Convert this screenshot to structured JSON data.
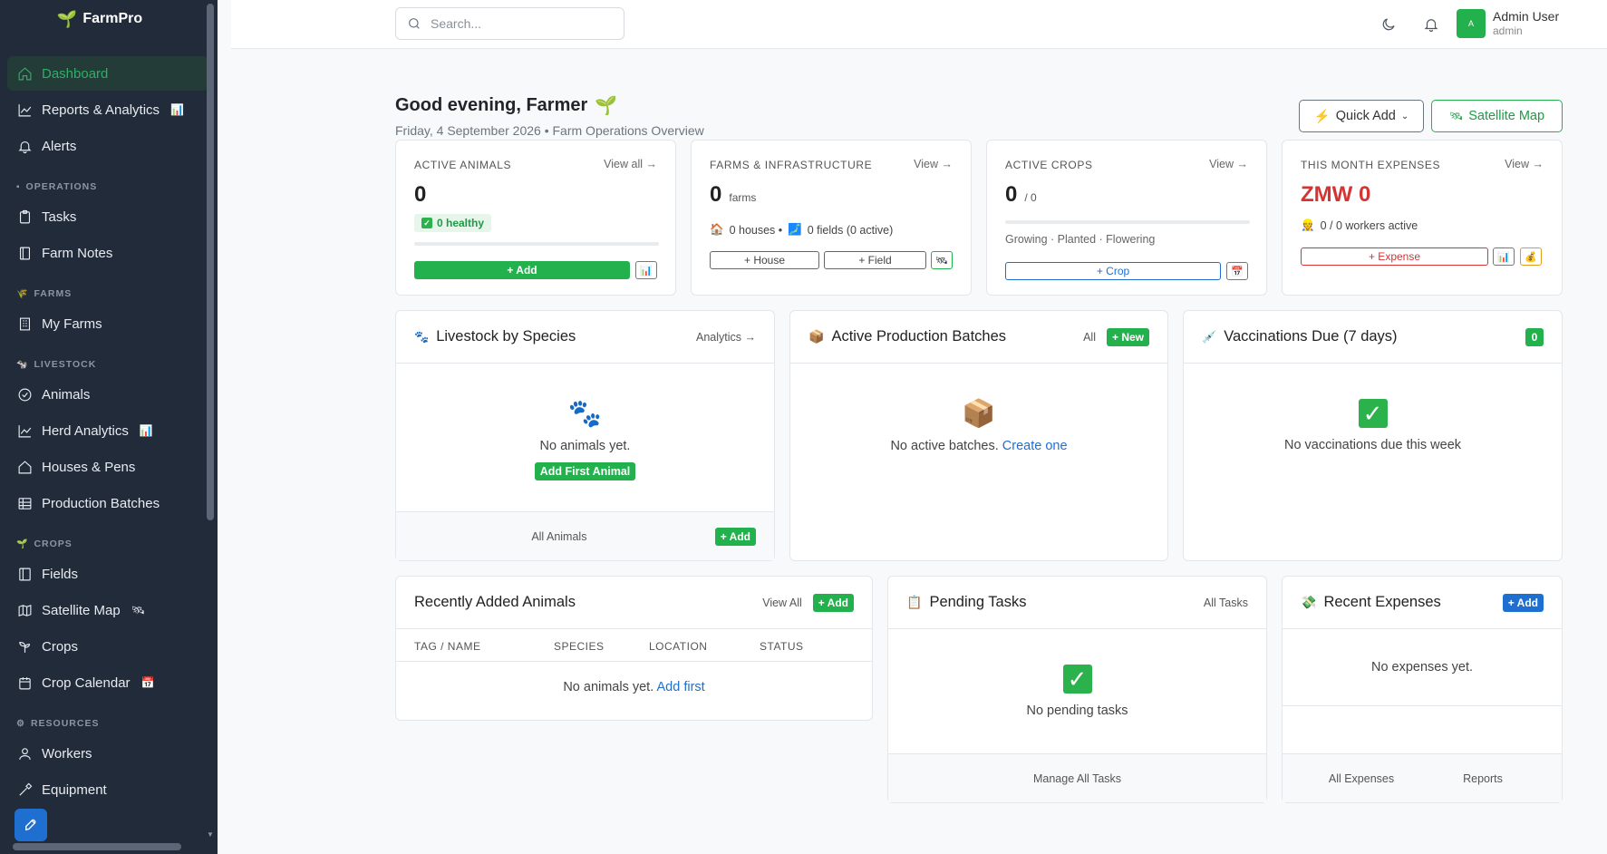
{
  "app": {
    "name": "FarmPro"
  },
  "sidebar": {
    "top": [
      {
        "label": "Dashboard"
      },
      {
        "label": "Reports & Analytics",
        "emoji": "📊"
      },
      {
        "label": "Alerts"
      }
    ],
    "sections": {
      "operations": {
        "label": "OPERATIONS",
        "emoji": "▪",
        "items": [
          {
            "label": "Tasks"
          },
          {
            "label": "Farm Notes"
          }
        ]
      },
      "farms": {
        "label": "FARMS",
        "emoji": "🌾",
        "items": [
          {
            "label": "My Farms"
          }
        ]
      },
      "livestock": {
        "label": "LIVESTOCK",
        "emoji": "🐄",
        "items": [
          {
            "label": "Animals"
          },
          {
            "label": "Herd Analytics",
            "emoji": "📊"
          },
          {
            "label": "Houses & Pens"
          },
          {
            "label": "Production Batches"
          }
        ]
      },
      "crops": {
        "label": "CROPS",
        "emoji": "🌱",
        "items": [
          {
            "label": "Fields"
          },
          {
            "label": "Satellite Map",
            "emoji": "🛰"
          },
          {
            "label": "Crops"
          },
          {
            "label": "Crop Calendar",
            "emoji": "📅"
          }
        ]
      },
      "resources": {
        "label": "RESOURCES",
        "emoji": "⚙",
        "items": [
          {
            "label": "Workers"
          },
          {
            "label": "Equipment"
          }
        ]
      }
    }
  },
  "topbar": {
    "search_placeholder": "Search...",
    "user": {
      "name": "Admin User",
      "role": "admin",
      "initial": "A"
    }
  },
  "header": {
    "greeting": "Good evening, Farmer",
    "greeting_emoji": "🌱",
    "subtitle": "Friday, 4 September 2026 • Farm Operations Overview",
    "quick_add": "Quick Add",
    "satellite_map": "Satellite Map"
  },
  "stats": {
    "animals": {
      "title": "ACTIVE ANIMALS",
      "link": "View all →",
      "value": "0",
      "healthy": "0 healthy",
      "add": "+ Add",
      "progress": 0
    },
    "farms": {
      "title": "FARMS & INFRASTRUCTURE",
      "link": "View →",
      "value": "0",
      "unit": "farms",
      "houses": "0 houses •",
      "fields": "0 fields (0 active)",
      "add_house": "+ House",
      "add_field": "+ Field"
    },
    "crops": {
      "title": "ACTIVE CROPS",
      "link": "View →",
      "value": "0",
      "unit": "/ 0",
      "stages": "Growing · Planted · Flowering",
      "add": "+ Crop",
      "progress": 0
    },
    "expenses": {
      "title": "THIS MONTH EXPENSES",
      "link": "View →",
      "value": "ZMW 0",
      "workers": "0 / 0 workers active",
      "add": "+ Expense"
    }
  },
  "panels": {
    "livestock": {
      "title": "Livestock by Species",
      "link": "Analytics →",
      "empty": "No animals yet.",
      "cta": "Add First Animal",
      "footer": "All Animals",
      "add": "+ Add"
    },
    "batches": {
      "title": "Active Production Batches",
      "link": "All",
      "new": "+ New",
      "empty": "No active batches.",
      "create": "Create one"
    },
    "vaccinations": {
      "title": "Vaccinations Due (7 days)",
      "count": "0",
      "empty": "No vaccinations due this week"
    },
    "recent_animals": {
      "title": "Recently Added Animals",
      "link": "View All",
      "add": "+ Add",
      "columns": [
        "TAG / NAME",
        "SPECIES",
        "LOCATION",
        "STATUS"
      ],
      "empty": "No animals yet.",
      "add_first": "Add first"
    },
    "tasks": {
      "title": "Pending Tasks",
      "link": "All Tasks",
      "empty": "No pending tasks",
      "footer": "Manage All Tasks"
    },
    "expenses": {
      "title": "Recent Expenses",
      "add": "+ Add",
      "empty": "No expenses yet.",
      "footer_left": "All Expenses",
      "footer_right": "Reports"
    }
  },
  "colors": {
    "accent_green": "#22b14c",
    "sidebar_bg": "#212b3a",
    "link_blue": "#1f6fd1",
    "danger_red": "#d63333"
  }
}
